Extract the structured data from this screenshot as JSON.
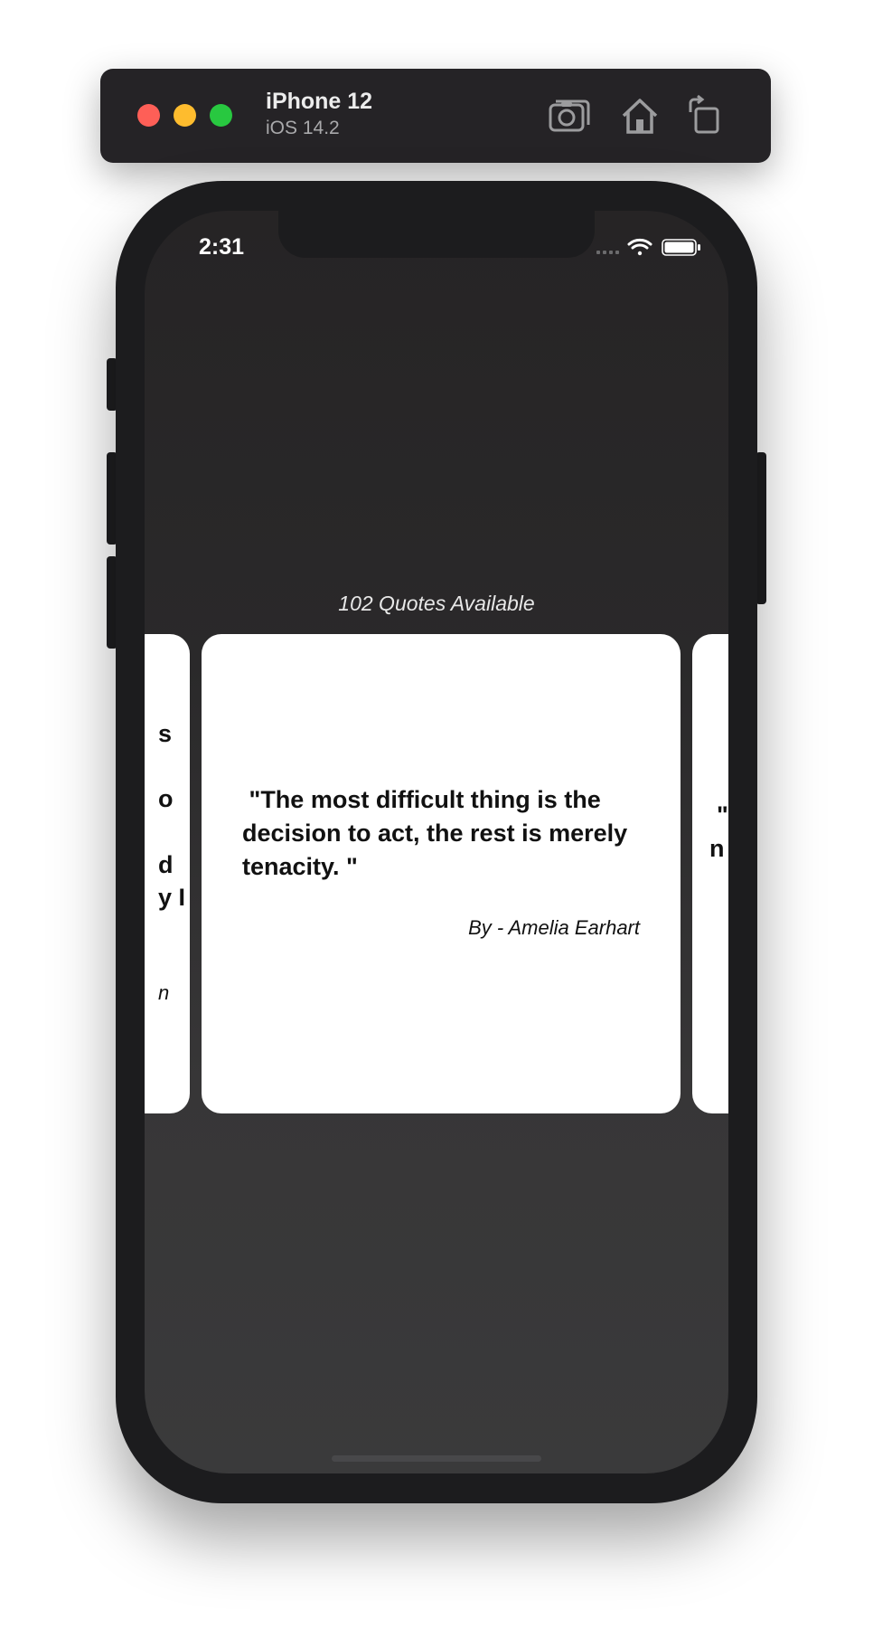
{
  "simulator": {
    "device_name": "iPhone 12",
    "os_version": "iOS 14.2",
    "toolbar": [
      {
        "name": "screenshot",
        "icon": "camera-icon"
      },
      {
        "name": "home",
        "icon": "home-icon"
      },
      {
        "name": "rotate",
        "icon": "rotate-icon"
      }
    ],
    "traffic_lights": {
      "close": "#fe5f57",
      "minimize": "#febc2e",
      "zoom": "#28c840"
    }
  },
  "status_bar": {
    "time": "2:31",
    "icons": [
      "cellular-icon",
      "wifi-icon",
      "battery-icon"
    ]
  },
  "main": {
    "quotes_count": "102 Quotes Available",
    "current_card": {
      "quote": " \"The most difficult thing is the decision to act, the rest is merely tenacity. \"",
      "author": "By - Amelia Earhart"
    },
    "previous_card_fragments": [
      "s",
      "o",
      "d",
      "y I",
      "n"
    ],
    "next_card_fragments": [
      "\"",
      "n"
    ]
  },
  "colors": {
    "screen_background": "#2a292a",
    "card_background": "#ffffff",
    "text_on_card": "#111111"
  }
}
